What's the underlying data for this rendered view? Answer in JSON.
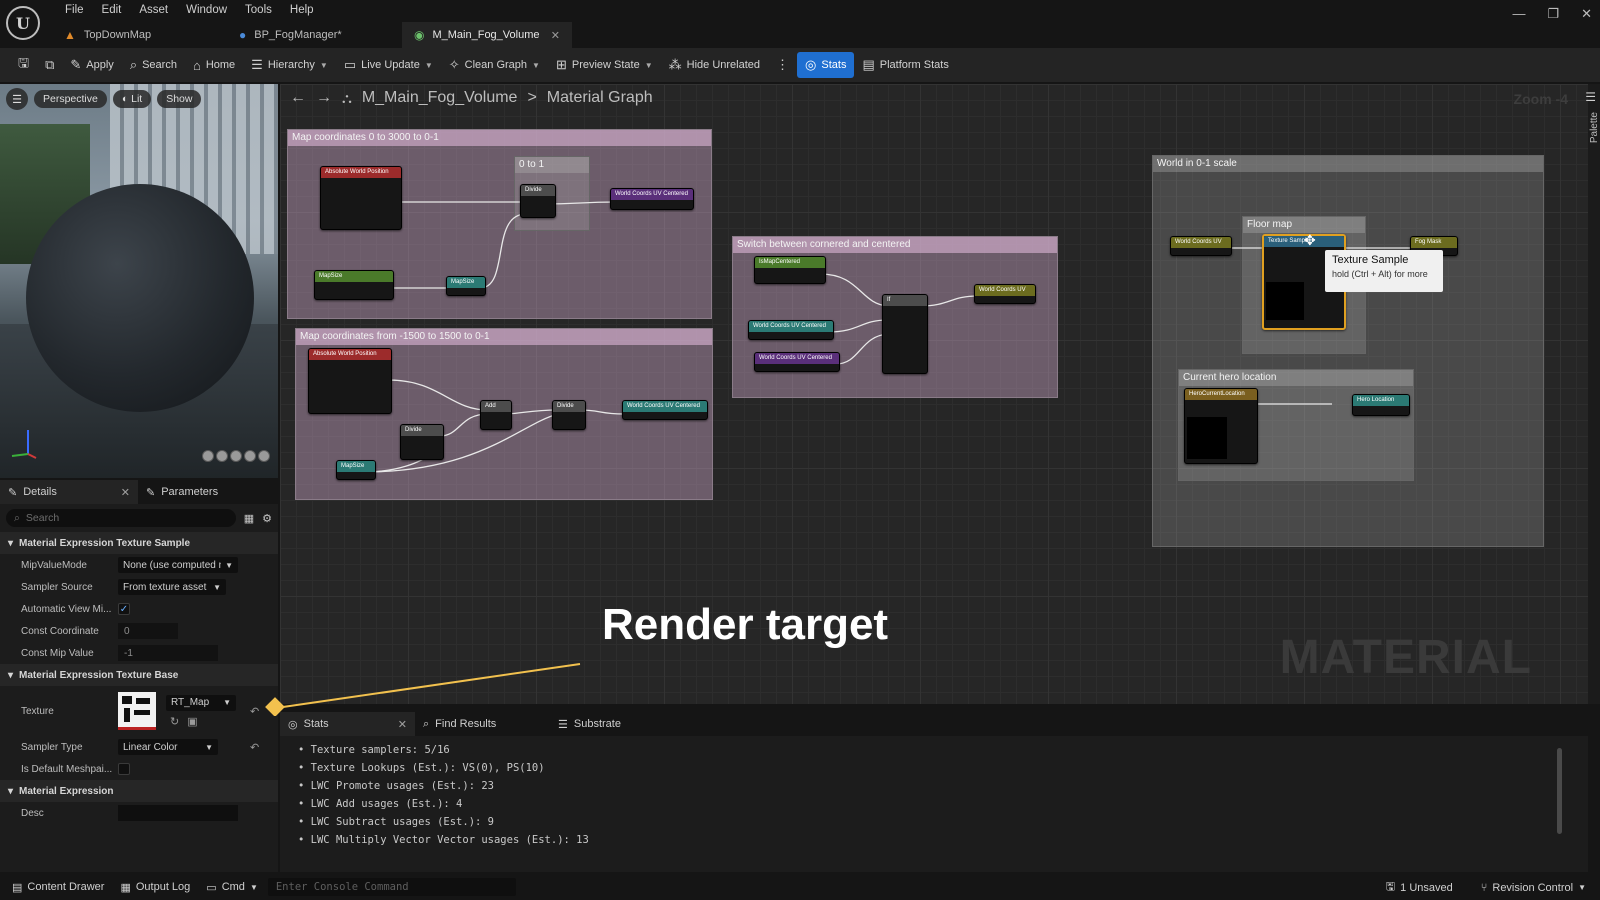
{
  "menu": [
    "File",
    "Edit",
    "Asset",
    "Window",
    "Tools",
    "Help"
  ],
  "tabs": [
    {
      "label": "TopDownMap",
      "icon": "level-icon"
    },
    {
      "label": "BP_FogManager*",
      "icon": "blueprint-icon"
    },
    {
      "label": "M_Main_Fog_Volume",
      "icon": "material-icon",
      "active": true
    }
  ],
  "toolbar": {
    "apply": "Apply",
    "search": "Search",
    "home": "Home",
    "hierarchy": "Hierarchy",
    "live_update": "Live Update",
    "clean_graph": "Clean Graph",
    "preview_state": "Preview State",
    "hide_unrelated": "Hide Unrelated",
    "stats": "Stats",
    "platform_stats": "Platform Stats"
  },
  "viewport": {
    "perspective": "Perspective",
    "lit": "Lit",
    "show": "Show"
  },
  "details": {
    "tab_details": "Details",
    "tab_parameters": "Parameters",
    "search_placeholder": "Search",
    "sections": {
      "texture_sample": "Material Expression Texture Sample",
      "texture_base": "Material Expression Texture Base",
      "expression": "Material Expression"
    },
    "props": {
      "mip_value_mode_label": "MipValueMode",
      "mip_value_mode_value": "None (use computed n",
      "sampler_source_label": "Sampler Source",
      "sampler_source_value": "From texture asset",
      "auto_view_mip_label": "Automatic View Mi...",
      "const_coordinate_label": "Const Coordinate",
      "const_coordinate_value": "0",
      "const_mip_label": "Const Mip Value",
      "const_mip_value": "-1",
      "texture_label": "Texture",
      "texture_value": "RT_Map",
      "sampler_type_label": "Sampler Type",
      "sampler_type_value": "Linear Color",
      "is_default_mesh_label": "Is Default Meshpai...",
      "desc_label": "Desc"
    }
  },
  "graph": {
    "breadcrumb_asset": "M_Main_Fog_Volume",
    "breadcrumb_sep": ">",
    "breadcrumb_view": "Material Graph",
    "zoom": "Zoom -4",
    "palette": "Palette",
    "watermark": "MATERIAL",
    "comments": {
      "c1": "Map coordinates 0 to 3000 to 0-1",
      "c1_inner": "0 to 1",
      "c2": "Map coordinates from -1500 to 1500 to 0-1",
      "c3": "Switch between cornered and centered",
      "c4": "World in 0-1 scale",
      "c4_inner": "Floor map",
      "c5": "Current hero location"
    },
    "nodes": {
      "abs_world_pos": "Absolute World Position",
      "divide": "Divide",
      "world_coords_uv_centered": "World Coords UV Centered",
      "map_size": "MapSize",
      "add": "Add",
      "is_map_centered": "IsMapCentered",
      "if": "If",
      "world_coords_uv": "World Coords UV",
      "texture_sample": "Texture Sample",
      "fog_mask": "Fog Mask",
      "hero_location_param": "HeroCurrentLocation",
      "hero_location": "Hero Location"
    },
    "tooltip_title": "Texture Sample",
    "tooltip_hint": "hold (Ctrl + Alt) for more"
  },
  "annotation": "Render target",
  "stats": {
    "tab_stats": "Stats",
    "tab_find": "Find Results",
    "tab_substrate": "Substrate",
    "lines": [
      "Texture samplers: 5/16",
      "Texture Lookups (Est.): VS(0), PS(10)",
      "LWC Promote usages (Est.): 23",
      "LWC Add usages (Est.): 4",
      "LWC Subtract usages (Est.): 9",
      "LWC Multiply Vector Vector usages (Est.): 13"
    ]
  },
  "statusbar": {
    "content_drawer": "Content Drawer",
    "output_log": "Output Log",
    "cmd": "Cmd",
    "console_placeholder": "Enter Console Command",
    "unsaved": "1 Unsaved",
    "revision_control": "Revision Control"
  },
  "colors": {
    "accent": "#1f6fd1",
    "annotation_line": "#f2c14e"
  }
}
